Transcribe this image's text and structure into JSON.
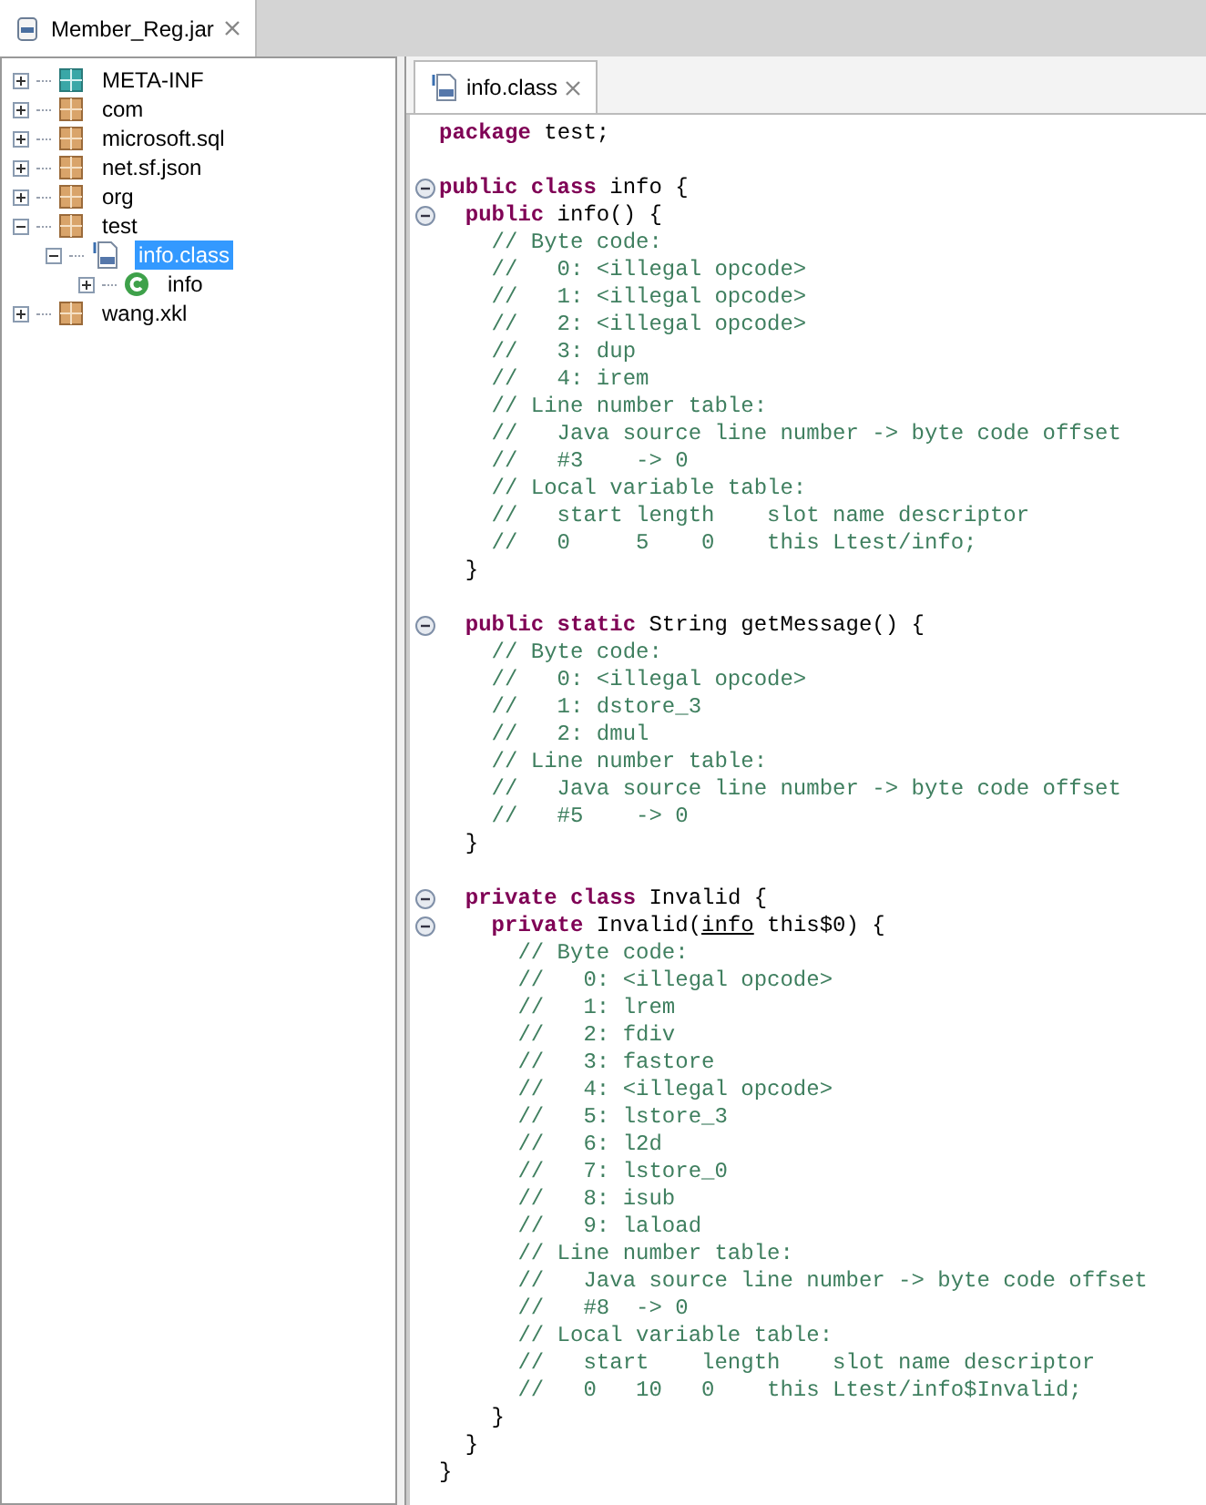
{
  "outer_tab": {
    "label": "Member_Reg.jar",
    "selected": true
  },
  "tree": [
    {
      "label": "META-INF",
      "kind": "folder",
      "expanded": false,
      "selected": false
    },
    {
      "label": "com",
      "kind": "package",
      "expanded": false,
      "selected": false
    },
    {
      "label": "microsoft.sql",
      "kind": "package",
      "expanded": false,
      "selected": false
    },
    {
      "label": "net.sf.json",
      "kind": "package",
      "expanded": false,
      "selected": false
    },
    {
      "label": "org",
      "kind": "package",
      "expanded": false,
      "selected": false
    },
    {
      "label": "test",
      "kind": "package",
      "expanded": true,
      "selected": false,
      "children": [
        {
          "label": "info.class",
          "kind": "classfile",
          "expanded": true,
          "selected": true,
          "children": [
            {
              "label": "info",
              "kind": "class",
              "expanded": false,
              "selected": false
            }
          ]
        }
      ]
    },
    {
      "label": "wang.xkl",
      "kind": "package",
      "expanded": false,
      "selected": false
    }
  ],
  "editor_tab": {
    "label": "info.class",
    "selected": true
  },
  "code": [
    {
      "kind": "code",
      "fold": false,
      "tokens": [
        {
          "kind": "keyword",
          "text": "package"
        },
        {
          "kind": "plain",
          "text": " test;"
        }
      ]
    },
    {
      "kind": "blank",
      "fold": false
    },
    {
      "kind": "code",
      "fold": true,
      "tokens": [
        {
          "kind": "keyword",
          "text": "public class"
        },
        {
          "kind": "plain",
          "text": " info {"
        }
      ]
    },
    {
      "kind": "code",
      "fold": true,
      "tokens": [
        {
          "kind": "keyword",
          "text": "  public"
        },
        {
          "kind": "plain",
          "text": " info() {"
        }
      ]
    },
    {
      "kind": "code",
      "fold": false,
      "tokens": [
        {
          "kind": "comment",
          "text": "    // Byte code:"
        }
      ]
    },
    {
      "kind": "code",
      "fold": false,
      "tokens": [
        {
          "kind": "comment",
          "text": "    //   0: <illegal opcode>"
        }
      ]
    },
    {
      "kind": "code",
      "fold": false,
      "tokens": [
        {
          "kind": "comment",
          "text": "    //   1: <illegal opcode>"
        }
      ]
    },
    {
      "kind": "code",
      "fold": false,
      "tokens": [
        {
          "kind": "comment",
          "text": "    //   2: <illegal opcode>"
        }
      ]
    },
    {
      "kind": "code",
      "fold": false,
      "tokens": [
        {
          "kind": "comment",
          "text": "    //   3: dup"
        }
      ]
    },
    {
      "kind": "code",
      "fold": false,
      "tokens": [
        {
          "kind": "comment",
          "text": "    //   4: irem"
        }
      ]
    },
    {
      "kind": "code",
      "fold": false,
      "tokens": [
        {
          "kind": "comment",
          "text": "    // Line number table:"
        }
      ]
    },
    {
      "kind": "code",
      "fold": false,
      "tokens": [
        {
          "kind": "comment",
          "text": "    //   Java source line number -> byte code offset"
        }
      ]
    },
    {
      "kind": "code",
      "fold": false,
      "tokens": [
        {
          "kind": "comment",
          "text": "    //   #3    -> 0"
        }
      ]
    },
    {
      "kind": "code",
      "fold": false,
      "tokens": [
        {
          "kind": "comment",
          "text": "    // Local variable table:"
        }
      ]
    },
    {
      "kind": "code",
      "fold": false,
      "tokens": [
        {
          "kind": "comment",
          "text": "    //   start length    slot name descriptor"
        }
      ]
    },
    {
      "kind": "code",
      "fold": false,
      "tokens": [
        {
          "kind": "comment",
          "text": "    //   0     5    0    this Ltest/info;"
        }
      ]
    },
    {
      "kind": "code",
      "fold": false,
      "tokens": [
        {
          "kind": "plain",
          "text": "  }"
        }
      ]
    },
    {
      "kind": "blank",
      "fold": false
    },
    {
      "kind": "code",
      "fold": true,
      "tokens": [
        {
          "kind": "keyword",
          "text": "  public static"
        },
        {
          "kind": "plain",
          "text": " String getMessage() {"
        }
      ]
    },
    {
      "kind": "code",
      "fold": false,
      "tokens": [
        {
          "kind": "comment",
          "text": "    // Byte code:"
        }
      ]
    },
    {
      "kind": "code",
      "fold": false,
      "tokens": [
        {
          "kind": "comment",
          "text": "    //   0: <illegal opcode>"
        }
      ]
    },
    {
      "kind": "code",
      "fold": false,
      "tokens": [
        {
          "kind": "comment",
          "text": "    //   1: dstore_3"
        }
      ]
    },
    {
      "kind": "code",
      "fold": false,
      "tokens": [
        {
          "kind": "comment",
          "text": "    //   2: dmul"
        }
      ]
    },
    {
      "kind": "code",
      "fold": false,
      "tokens": [
        {
          "kind": "comment",
          "text": "    // Line number table:"
        }
      ]
    },
    {
      "kind": "code",
      "fold": false,
      "tokens": [
        {
          "kind": "comment",
          "text": "    //   Java source line number -> byte code offset"
        }
      ]
    },
    {
      "kind": "code",
      "fold": false,
      "tokens": [
        {
          "kind": "comment",
          "text": "    //   #5    -> 0"
        }
      ]
    },
    {
      "kind": "code",
      "fold": false,
      "tokens": [
        {
          "kind": "plain",
          "text": "  }"
        }
      ]
    },
    {
      "kind": "blank",
      "fold": false
    },
    {
      "kind": "code",
      "fold": true,
      "tokens": [
        {
          "kind": "keyword",
          "text": "  private class"
        },
        {
          "kind": "plain",
          "text": " Invalid {"
        }
      ]
    },
    {
      "kind": "code",
      "fold": true,
      "tokens": [
        {
          "kind": "keyword",
          "text": "    private"
        },
        {
          "kind": "plain",
          "text": " Invalid("
        },
        {
          "kind": "link",
          "text": "info"
        },
        {
          "kind": "plain",
          "text": " this$0) {"
        }
      ]
    },
    {
      "kind": "code",
      "fold": false,
      "tokens": [
        {
          "kind": "comment",
          "text": "      // Byte code:"
        }
      ]
    },
    {
      "kind": "code",
      "fold": false,
      "tokens": [
        {
          "kind": "comment",
          "text": "      //   0: <illegal opcode>"
        }
      ]
    },
    {
      "kind": "code",
      "fold": false,
      "tokens": [
        {
          "kind": "comment",
          "text": "      //   1: lrem"
        }
      ]
    },
    {
      "kind": "code",
      "fold": false,
      "tokens": [
        {
          "kind": "comment",
          "text": "      //   2: fdiv"
        }
      ]
    },
    {
      "kind": "code",
      "fold": false,
      "tokens": [
        {
          "kind": "comment",
          "text": "      //   3: fastore"
        }
      ]
    },
    {
      "kind": "code",
      "fold": false,
      "tokens": [
        {
          "kind": "comment",
          "text": "      //   4: <illegal opcode>"
        }
      ]
    },
    {
      "kind": "code",
      "fold": false,
      "tokens": [
        {
          "kind": "comment",
          "text": "      //   5: lstore_3"
        }
      ]
    },
    {
      "kind": "code",
      "fold": false,
      "tokens": [
        {
          "kind": "comment",
          "text": "      //   6: l2d"
        }
      ]
    },
    {
      "kind": "code",
      "fold": false,
      "tokens": [
        {
          "kind": "comment",
          "text": "      //   7: lstore_0"
        }
      ]
    },
    {
      "kind": "code",
      "fold": false,
      "tokens": [
        {
          "kind": "comment",
          "text": "      //   8: isub"
        }
      ]
    },
    {
      "kind": "code",
      "fold": false,
      "tokens": [
        {
          "kind": "comment",
          "text": "      //   9: laload"
        }
      ]
    },
    {
      "kind": "code",
      "fold": false,
      "tokens": [
        {
          "kind": "comment",
          "text": "      // Line number table:"
        }
      ]
    },
    {
      "kind": "code",
      "fold": false,
      "tokens": [
        {
          "kind": "comment",
          "text": "      //   Java source line number -> byte code offset"
        }
      ]
    },
    {
      "kind": "code",
      "fold": false,
      "tokens": [
        {
          "kind": "comment",
          "text": "      //   #8  -> 0"
        }
      ]
    },
    {
      "kind": "code",
      "fold": false,
      "tokens": [
        {
          "kind": "comment",
          "text": "      // Local variable table:"
        }
      ]
    },
    {
      "kind": "code",
      "fold": false,
      "tokens": [
        {
          "kind": "comment",
          "text": "      //   start    length    slot name descriptor"
        }
      ]
    },
    {
      "kind": "code",
      "fold": false,
      "tokens": [
        {
          "kind": "comment",
          "text": "      //   0   10   0    this Ltest/info$Invalid;"
        }
      ]
    },
    {
      "kind": "code",
      "fold": false,
      "tokens": [
        {
          "kind": "plain",
          "text": "    }"
        }
      ]
    },
    {
      "kind": "code",
      "fold": false,
      "tokens": [
        {
          "kind": "plain",
          "text": "  }"
        }
      ]
    },
    {
      "kind": "code",
      "fold": false,
      "tokens": [
        {
          "kind": "plain",
          "text": "}"
        }
      ]
    }
  ]
}
